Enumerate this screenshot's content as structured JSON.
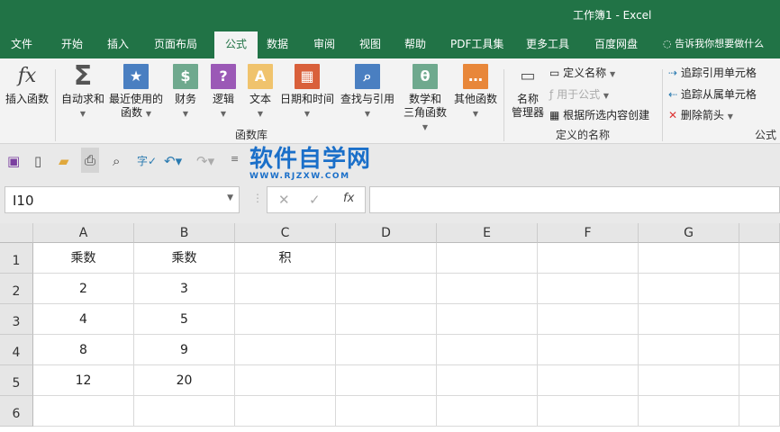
{
  "title": "工作簿1  -  Excel",
  "tabs": [
    "文件",
    "开始",
    "插入",
    "页面布局",
    "公式",
    "数据",
    "审阅",
    "视图",
    "帮助",
    "PDF工具集",
    "更多工具",
    "百度网盘"
  ],
  "active_tab": "公式",
  "tell_me": "告诉我你想要做什么",
  "ribbon": {
    "insert_function": "插入函数",
    "library": [
      {
        "l1": "自动求和",
        "l2": "",
        "icon": "sigma-icon",
        "color": "#555555"
      },
      {
        "l1": "最近使用的",
        "l2": "函数",
        "icon": "star-book-icon",
        "color": "#4a7fc1"
      },
      {
        "l1": "财务",
        "l2": "",
        "icon": "coins-book-icon",
        "color": "#6fa98e"
      },
      {
        "l1": "逻辑",
        "l2": "",
        "icon": "question-book-icon",
        "color": "#9b59b6"
      },
      {
        "l1": "文本",
        "l2": "",
        "icon": "text-book-icon",
        "color": "#f0c36d"
      },
      {
        "l1": "日期和时间",
        "l2": "",
        "icon": "calendar-book-icon",
        "color": "#d9603b"
      },
      {
        "l1": "查找与引用",
        "l2": "",
        "icon": "search-book-icon",
        "color": "#4a7fc1"
      },
      {
        "l1": "数学和",
        "l2": "三角函数",
        "icon": "theta-book-icon",
        "color": "#6fa98e"
      },
      {
        "l1": "其他函数",
        "l2": "",
        "icon": "more-book-icon",
        "color": "#e8873a"
      }
    ],
    "library_group": "函数库",
    "name_manager": [
      "名称",
      "管理器"
    ],
    "define_name": "定义名称",
    "use_in_formula": "用于公式",
    "create_from_selection": "根据所选内容创建",
    "names_group": "定义的名称",
    "trace_precedents": "追踪引用单元格",
    "trace_dependents": "追踪从属单元格",
    "remove_arrows": "删除箭头",
    "audit_group": "公式"
  },
  "watermark": {
    "cn": "软件自学网",
    "url": "WWW.RJZXW.COM"
  },
  "name_box": "I10",
  "formula": "",
  "columns": [
    "A",
    "B",
    "C",
    "D",
    "E",
    "F",
    "G"
  ],
  "rows": [
    [
      "乘数",
      "乘数",
      "积",
      "",
      "",
      "",
      ""
    ],
    [
      "2",
      "3",
      "",
      "",
      "",
      "",
      ""
    ],
    [
      "4",
      "5",
      "",
      "",
      "",
      "",
      ""
    ],
    [
      "8",
      "9",
      "",
      "",
      "",
      "",
      ""
    ],
    [
      "12",
      "20",
      "",
      "",
      "",
      "",
      ""
    ],
    [
      "",
      "",
      "",
      "",
      "",
      "",
      ""
    ]
  ]
}
